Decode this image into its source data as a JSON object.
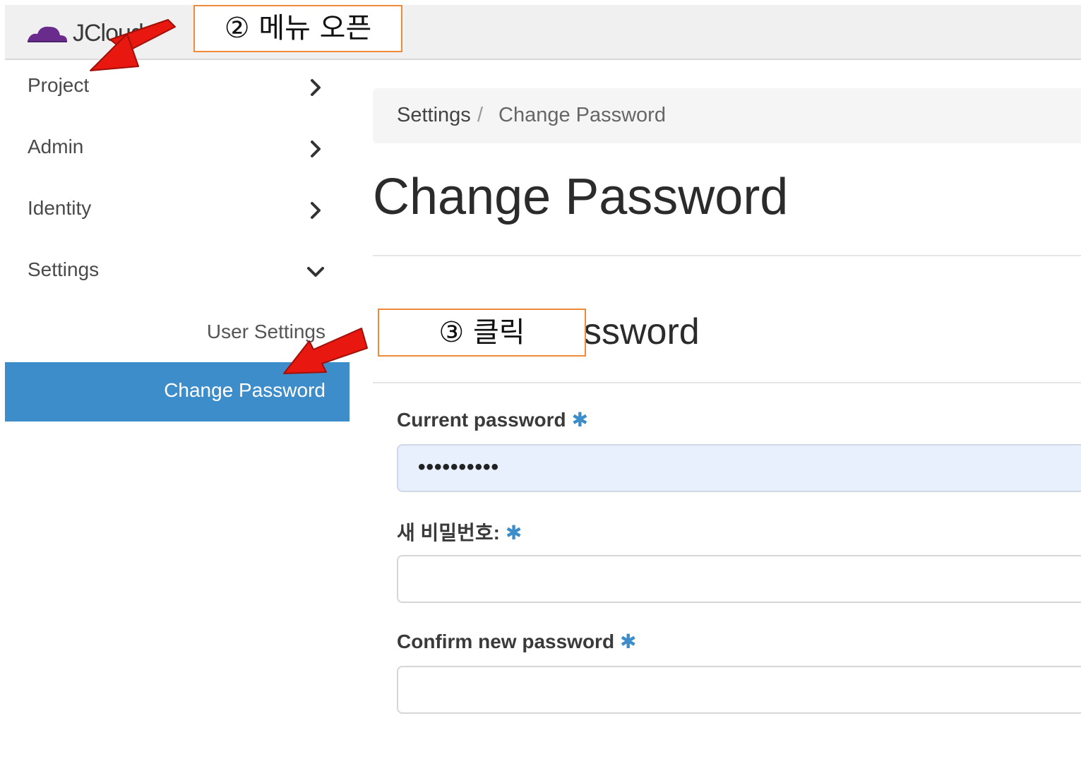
{
  "app": {
    "logo_text": "JCloud"
  },
  "sidebar": {
    "items": [
      {
        "label": "Project",
        "state": "collapsed"
      },
      {
        "label": "Admin",
        "state": "collapsed"
      },
      {
        "label": "Identity",
        "state": "collapsed"
      },
      {
        "label": "Settings",
        "state": "expanded"
      }
    ],
    "sub_items": [
      {
        "label": "User Settings",
        "active": false
      },
      {
        "label": "Change Password",
        "active": true
      }
    ]
  },
  "breadcrumb": {
    "parent": "Settings",
    "separator": "/",
    "current": "Change Password"
  },
  "page": {
    "title": "Change Password",
    "section_title_visible": "ssword"
  },
  "form": {
    "required_marker": "✱",
    "fields": [
      {
        "label": "Current password",
        "value": "••••••••••"
      },
      {
        "label": "새 비밀번호:",
        "value": ""
      },
      {
        "label": "Confirm new password",
        "value": ""
      }
    ]
  },
  "annotations": {
    "step2": "② 메뉴 오픈",
    "step3": "③ 클릭",
    "arrow_color": "#e8170f"
  },
  "colors": {
    "accent": "#3d8dcb",
    "callout_border": "#ee8a3a",
    "logo": "#6a2c8c"
  }
}
